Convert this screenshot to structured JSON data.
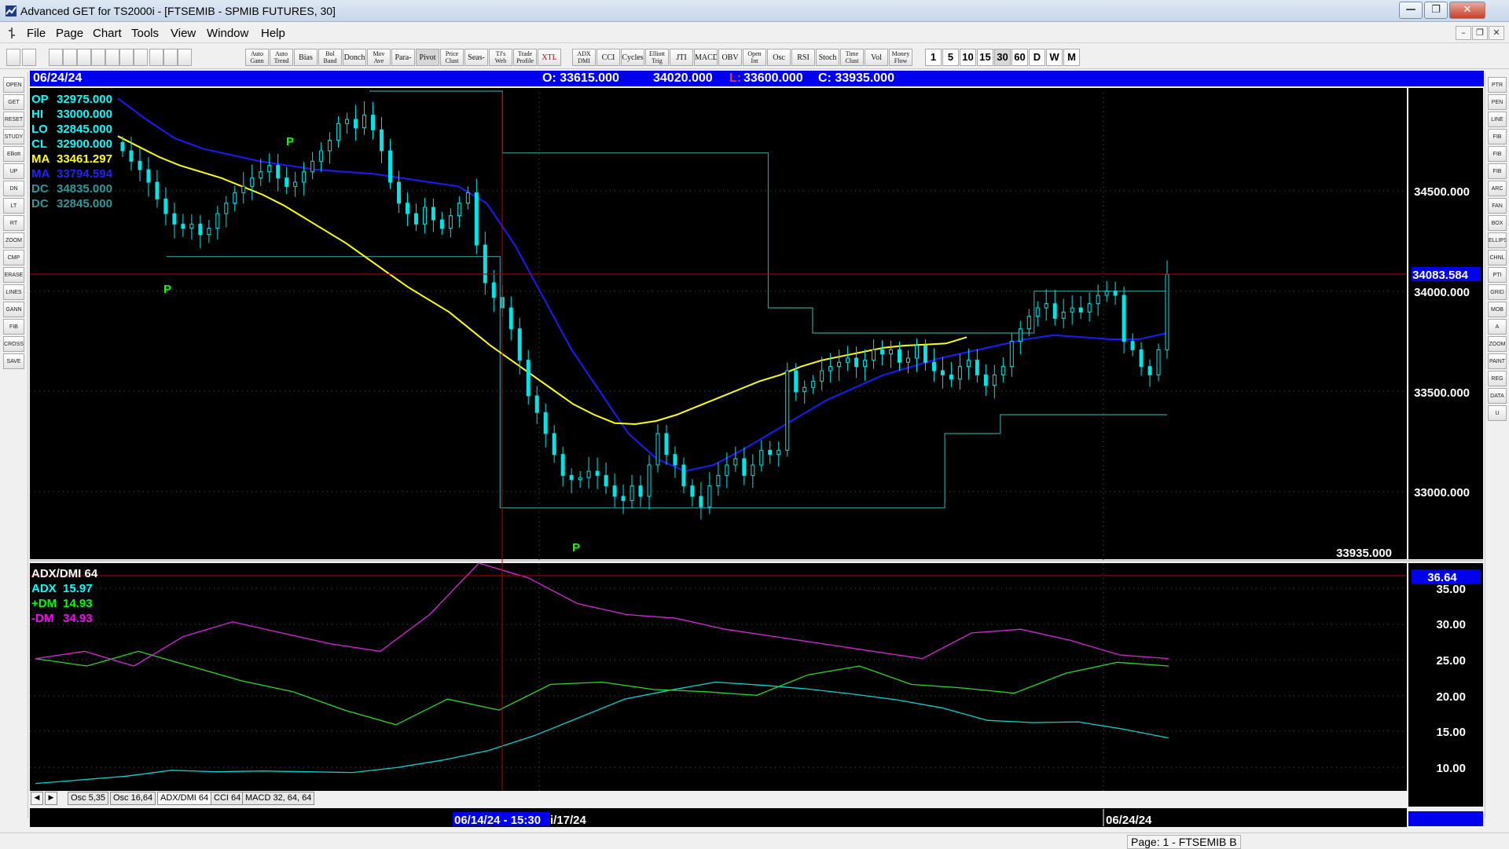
{
  "window": {
    "title": "Advanced GET for TS2000i - [FTSEMIB - SPMIB FUTURES, 30]",
    "buttons": {
      "minimize": "—",
      "maximize": "❐",
      "close": "✕"
    }
  },
  "menubar": {
    "items": [
      "File",
      "Page",
      "Chart",
      "Tools",
      "View",
      "Window",
      "Help"
    ],
    "mdi": [
      "–",
      "❐",
      "✕"
    ]
  },
  "toolbar": {
    "buttons": [
      "Auto Gann",
      "Auto Trend",
      "Bias",
      "Bol Band",
      "Donch",
      "Mov Ave",
      "Para-bolic",
      "Pivot",
      "Price Clust",
      "Seas-onals",
      "TJ's Web",
      "Trade Profile",
      "XTL",
      "ADX DMI",
      "CCI",
      "Cycles",
      "Elliott Trig",
      "JTI",
      "MACD",
      "OBV",
      "Open Int",
      "Osc",
      "RSI",
      "Stoch",
      "Time Clust",
      "Vol",
      "Money Flow"
    ],
    "periods": [
      "1",
      "5",
      "10",
      "15",
      "30",
      "60",
      "D",
      "W",
      "M"
    ],
    "selected_period": "30"
  },
  "lefttoolbar": [
    "OPEN",
    "GET",
    "RESET",
    "STUDY",
    "Elliott",
    "UP",
    "DN",
    "LT",
    "RT",
    "ZOOM",
    "CMP",
    "ERASE",
    "LINES",
    "GANN",
    "FIB",
    "CROSS",
    "SAVE"
  ],
  "righttoolbar": [
    "PTR",
    "PEN",
    "LINE",
    "FIB RET",
    "FIB EXT",
    "FIB TIME",
    "ARC",
    "FAN",
    "BOX",
    "ELLIPS",
    "CHNL",
    "PTI",
    "GRID",
    "MOB",
    "A",
    "ZOOM",
    "PAINT",
    "REG",
    "DATA",
    "U"
  ],
  "infobar": {
    "date": "06/24/24",
    "open": "O: 33615.000",
    "high": "34020.000",
    "low_label": "L:",
    "low": "33600.000",
    "close": "C: 33935.000"
  },
  "price_legend": [
    {
      "label": "OP",
      "value": "32975.000",
      "color": "#00ffff"
    },
    {
      "label": "HI",
      "value": "33000.000",
      "color": "#00ffff"
    },
    {
      "label": "LO",
      "value": "32845.000",
      "color": "#00ffff"
    },
    {
      "label": "CL",
      "value": "32900.000",
      "color": "#00ffff"
    },
    {
      "label": "MA",
      "value": "33461.297",
      "color": "#ffff00"
    },
    {
      "label": "MA",
      "value": "33794.594",
      "color": "#2222ff"
    },
    {
      "label": "DC",
      "value": "34835.000",
      "color": "#2a9a9a"
    },
    {
      "label": "DC",
      "value": "32845.000",
      "color": "#2a9a9a"
    }
  ],
  "pivots": [
    "P",
    "P",
    "P"
  ],
  "price_axis": {
    "ticks": [
      "34500.000",
      "34000.000",
      "33500.000",
      "33000.000"
    ],
    "marker": "34083.584",
    "last": "33935.000"
  },
  "indicator": {
    "title": "ADX/DMI 64",
    "legend": [
      {
        "label": "ADX",
        "value": "15.97",
        "color": "#00ffff"
      },
      {
        "label": "+DM",
        "value": "14.93",
        "color": "#00ff00"
      },
      {
        "label": "-DM",
        "value": "34.93",
        "color": "#ff00ff"
      }
    ],
    "ticks": [
      "35.00",
      "30.00",
      "25.00",
      "20.00",
      "15.00",
      "10.00"
    ],
    "marker": "36.64"
  },
  "tabs": [
    "Osc 5,35",
    "Osc 16,64",
    "ADX/DMI 64",
    "CCI 64",
    "MACD 32, 64, 64"
  ],
  "active_tab": "ADX/DMI 64",
  "time_axis": {
    "cursor_label": "06/14/24 - 15:30",
    "date_label": "i/17/24",
    "right_label": "06/24/24"
  },
  "status": {
    "page": "Page: 1 - FTSEMIB B"
  },
  "chart_data": [
    {
      "type": "candlestick",
      "title": "FTSEMIB - SPMIB FUTURES, 30",
      "ylim": [
        32600,
        34850
      ],
      "bars": 122,
      "close": [
        34550,
        34500,
        34460,
        34400,
        34320,
        34250,
        34200,
        34180,
        34200,
        34150,
        34180,
        34250,
        34300,
        34350,
        34380,
        34420,
        34450,
        34480,
        34420,
        34380,
        34400,
        34450,
        34500,
        34550,
        34600,
        34680,
        34700,
        34660,
        34720,
        34650,
        34550,
        34400,
        34300,
        34250,
        34200,
        34280,
        34220,
        34180,
        34240,
        34300,
        34350,
        34100,
        33920,
        33850,
        33800,
        33700,
        33550,
        33380,
        33300,
        33200,
        33100,
        33000,
        32980,
        32990,
        33020,
        33000,
        32950,
        32900,
        32880,
        32950,
        32900,
        33050,
        33200,
        33100,
        33050,
        32950,
        32900,
        32850,
        32950,
        33000,
        33050,
        33080,
        33000,
        33050,
        33120,
        33100,
        33120,
        33500,
        33400,
        33420,
        33450,
        33500,
        33520,
        33540,
        33560,
        33520,
        33550,
        33600,
        33580,
        33600,
        33540,
        33560,
        33620,
        33540,
        33500,
        33480,
        33460,
        33520,
        33550,
        33480,
        33430,
        33480,
        33520,
        33640,
        33700,
        33760,
        33800,
        33820,
        33750,
        33780,
        33800,
        33780,
        33820,
        33860,
        33880,
        33860,
        33640,
        33600,
        33520,
        33480,
        33600,
        33960
      ],
      "series": [
        {
          "name": "MA",
          "values": [
            34620,
            34570,
            34520,
            34480,
            34450,
            34420,
            34380,
            34340,
            34290,
            34230,
            34170,
            34110,
            34040,
            33970,
            33900,
            33840,
            33780,
            33700,
            33620,
            33550,
            33480,
            33410,
            33340,
            33290,
            33250,
            33245,
            33260,
            33290,
            33330,
            33370,
            33410,
            33450,
            33480,
            33520,
            33550,
            33570,
            33590,
            33610,
            33620,
            33625,
            33630,
            33660
          ]
        },
        {
          "name": "MA",
          "values": [
            34800,
            34700,
            34610,
            34560,
            34530,
            34500,
            34480,
            34460,
            34450,
            34440,
            34420,
            34400,
            34380,
            34300,
            34100,
            33850,
            33600,
            33400,
            33200,
            33080,
            33020,
            33050,
            33120,
            33200,
            33280,
            33360,
            33420,
            33480,
            33520,
            33560,
            33590,
            33620,
            33650,
            33670,
            33660,
            33650,
            33650,
            33680
          ]
        },
        {
          "name": "DC",
          "values": [
            34835,
            34835,
            34835,
            34540,
            34540,
            34540,
            34540,
            34540,
            34540,
            33800,
            33680,
            33680,
            33680,
            33680,
            33680,
            33880,
            33880,
            33880,
            33880
          ]
        },
        {
          "name": "DC",
          "values": [
            34045,
            34045,
            34045,
            34045,
            34045,
            34045,
            32845,
            32845,
            32845,
            32845,
            32845,
            32845,
            32845,
            32845,
            33200,
            33290,
            33290,
            33290,
            33290
          ]
        }
      ]
    },
    {
      "type": "line",
      "title": "ADX/DMI 64",
      "ylim": [
        6,
        37
      ],
      "series": [
        {
          "name": "ADX",
          "values": [
            7,
            7.5,
            8,
            8.8,
            8.6,
            8.7,
            8.6,
            8.5,
            9.2,
            10.2,
            11.5,
            13.5,
            16,
            18.5,
            19.7,
            20.8,
            20.4,
            19.9,
            19.2,
            18.4,
            17.3,
            15.6,
            15.3,
            15.4,
            14.4,
            13.2
          ]
        },
        {
          "name": "+DM",
          "values": [
            24,
            23,
            25,
            23,
            21,
            19.5,
            17,
            15,
            18.5,
            17,
            20.5,
            20.8,
            19.8,
            19.5,
            19,
            21.8,
            23,
            20.5,
            20,
            19.3,
            22,
            23.5,
            23
          ]
        },
        {
          "name": "-DM",
          "values": [
            24,
            25,
            23,
            27,
            29,
            27.5,
            26,
            25,
            30,
            37,
            35,
            31.5,
            30,
            29.5,
            28,
            27,
            26,
            25,
            24,
            27.5,
            28,
            26.5,
            24.5,
            24
          ]
        }
      ]
    }
  ]
}
